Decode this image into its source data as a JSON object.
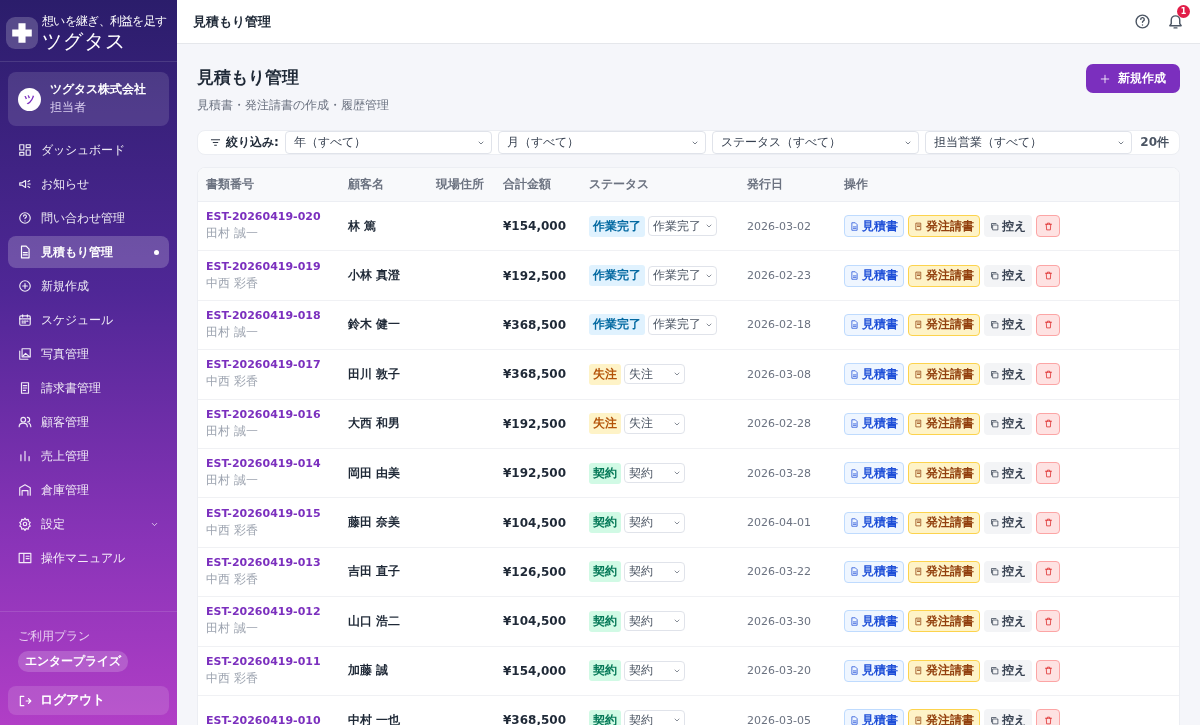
{
  "app": {
    "tagline": "想いを継ぎ、利益を足す",
    "name": "ツグタス"
  },
  "account": {
    "avatar": "ツ",
    "company": "ツグタス株式会社",
    "role": "担当者"
  },
  "nav": [
    {
      "label": "ダッシュボード",
      "selected": false
    },
    {
      "label": "お知らせ",
      "selected": false
    },
    {
      "label": "問い合わせ管理",
      "selected": false
    },
    {
      "label": "見積もり管理",
      "selected": true
    },
    {
      "label": "新規作成",
      "selected": false
    },
    {
      "label": "スケジュール",
      "selected": false
    },
    {
      "label": "写真管理",
      "selected": false
    },
    {
      "label": "請求書管理",
      "selected": false
    },
    {
      "label": "顧客管理",
      "selected": false
    },
    {
      "label": "売上管理",
      "selected": false
    },
    {
      "label": "倉庫管理",
      "selected": false
    },
    {
      "label": "設定",
      "selected": false,
      "expanded": false
    },
    {
      "label": "操作マニュアル",
      "selected": false
    }
  ],
  "plan": {
    "label": "ご利用プラン",
    "name": "エンタープライズ"
  },
  "logout": "ログアウト",
  "header": {
    "title": "見積もり管理",
    "notifications": "1"
  },
  "page": {
    "title": "見積もり管理",
    "subtitle": "見積書・発注請書の作成・履歴管理",
    "new_button": "新規作成"
  },
  "filters": {
    "label": "絞り込み:",
    "selects": [
      "年（すべて）",
      "月（すべて）",
      "ステータス（すべて）",
      "担当営業（すべて）"
    ],
    "count": "20件"
  },
  "table": {
    "columns": [
      "書類番号",
      "顧客名",
      "現場住所",
      "合計金額",
      "ステータス",
      "発行日",
      "操作"
    ],
    "rows": [
      {
        "id": "EST-20260419-020",
        "staff": "田村 誠一",
        "customer": "林 篤",
        "total": "¥154,000",
        "status": {
          "kind": "done",
          "label": "作業完了"
        },
        "status_value": "作業完了",
        "date": "2026-03-02",
        "actions": [
          "見積書",
          "発注請書",
          "控え"
        ]
      },
      {
        "id": "EST-20260419-019",
        "staff": "中西 彩香",
        "customer": "小林 真澄",
        "total": "¥192,500",
        "status": {
          "kind": "done",
          "label": "作業完了"
        },
        "status_value": "作業完了",
        "date": "2026-02-23",
        "actions": [
          "見積書",
          "発注請書",
          "控え"
        ]
      },
      {
        "id": "EST-20260419-018",
        "staff": "田村 誠一",
        "customer": "鈴木 健一",
        "total": "¥368,500",
        "status": {
          "kind": "done",
          "label": "作業完了"
        },
        "status_value": "作業完了",
        "date": "2026-02-18",
        "actions": [
          "見積書",
          "発注請書",
          "控え"
        ]
      },
      {
        "id": "EST-20260419-017",
        "staff": "中西 彩香",
        "customer": "田川 敦子",
        "total": "¥368,500",
        "status": {
          "kind": "lost",
          "label": "失注"
        },
        "status_value": "失注",
        "date": "2026-03-08",
        "actions": [
          "見積書",
          "発注請書",
          "控え"
        ]
      },
      {
        "id": "EST-20260419-016",
        "staff": "田村 誠一",
        "customer": "大西 和男",
        "total": "¥192,500",
        "status": {
          "kind": "lost",
          "label": "失注"
        },
        "status_value": "失注",
        "date": "2026-02-28",
        "actions": [
          "見積書",
          "発注請書",
          "控え"
        ]
      },
      {
        "id": "EST-20260419-014",
        "staff": "田村 誠一",
        "customer": "岡田 由美",
        "total": "¥192,500",
        "status": {
          "kind": "contract",
          "label": "契約"
        },
        "status_value": "契約",
        "date": "2026-03-28",
        "actions": [
          "見積書",
          "発注請書",
          "控え"
        ]
      },
      {
        "id": "EST-20260419-015",
        "staff": "中西 彩香",
        "customer": "藤田 奈美",
        "total": "¥104,500",
        "status": {
          "kind": "contract",
          "label": "契約"
        },
        "status_value": "契約",
        "date": "2026-04-01",
        "actions": [
          "見積書",
          "発注請書",
          "控え"
        ]
      },
      {
        "id": "EST-20260419-013",
        "staff": "中西 彩香",
        "customer": "吉田 直子",
        "total": "¥126,500",
        "status": {
          "kind": "contract",
          "label": "契約"
        },
        "status_value": "契約",
        "date": "2026-03-22",
        "actions": [
          "見積書",
          "発注請書",
          "控え"
        ]
      },
      {
        "id": "EST-20260419-012",
        "staff": "田村 誠一",
        "customer": "山口 浩二",
        "total": "¥104,500",
        "status": {
          "kind": "contract",
          "label": "契約"
        },
        "status_value": "契約",
        "date": "2026-03-30",
        "actions": [
          "見積書",
          "発注請書",
          "控え"
        ]
      },
      {
        "id": "EST-20260419-011",
        "staff": "中西 彩香",
        "customer": "加藤 誠",
        "total": "¥154,000",
        "status": {
          "kind": "contract",
          "label": "契約"
        },
        "status_value": "契約",
        "date": "2026-03-20",
        "actions": [
          "見積書",
          "発注請書",
          "控え"
        ]
      },
      {
        "id": "EST-20260419-010",
        "customer": "中村 一也",
        "total": "¥368,500",
        "status": {
          "kind": "contract",
          "label": "契約"
        },
        "status_value": "契約",
        "date": "2026-03-05",
        "actions": [
          "見積書",
          "発注請書",
          "控え"
        ]
      }
    ]
  }
}
